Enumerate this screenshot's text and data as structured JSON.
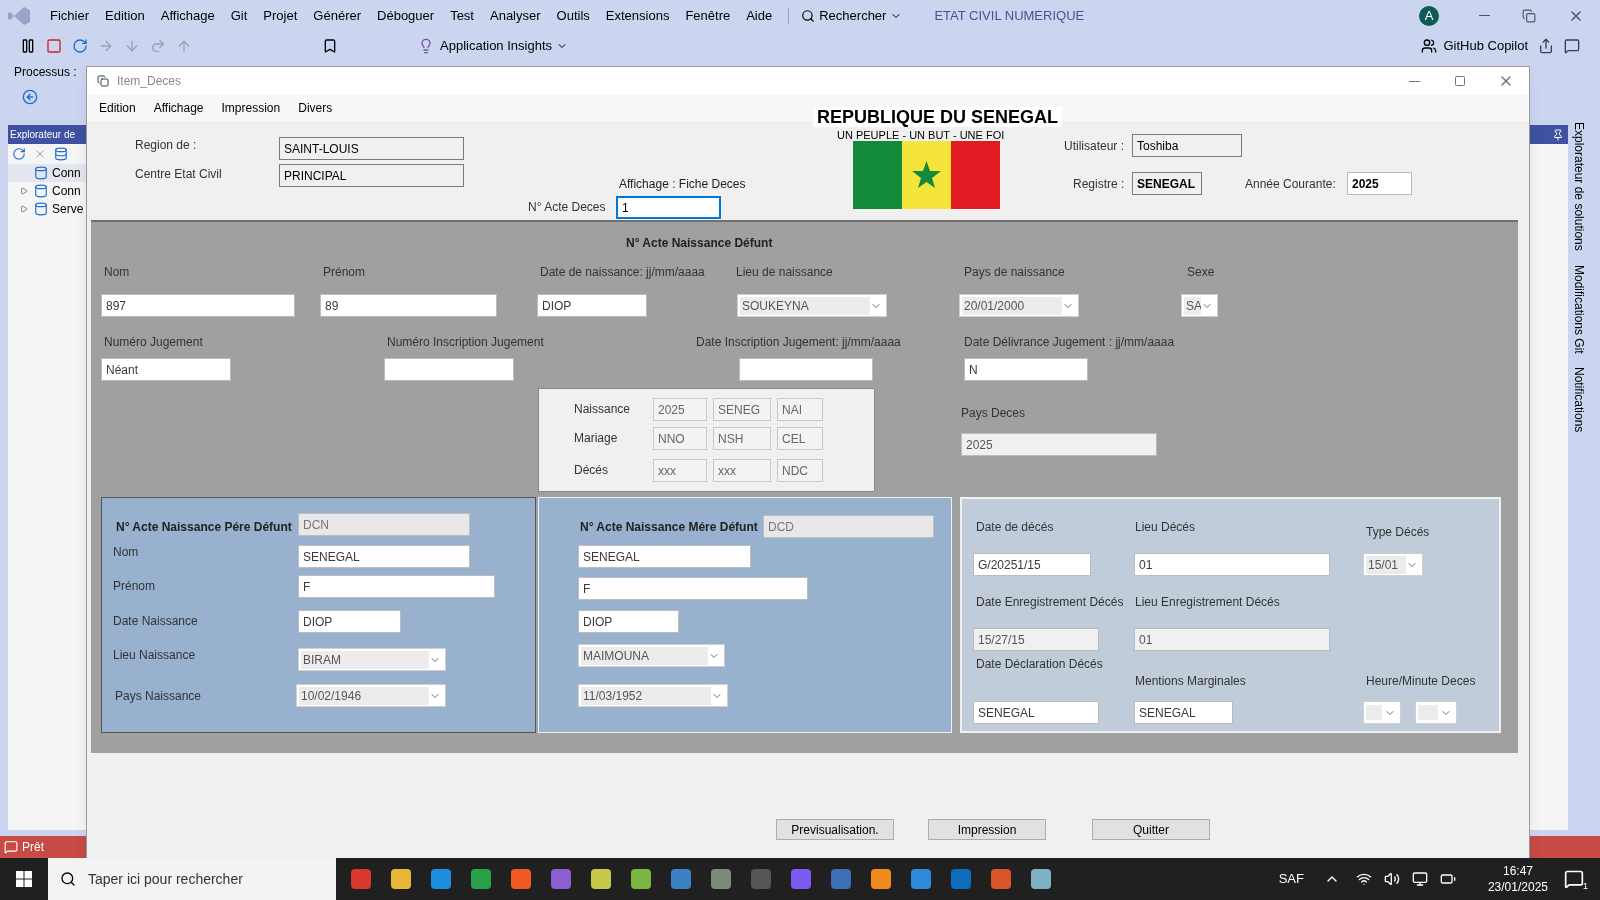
{
  "ide": {
    "menu": [
      "Fichier",
      "Edition",
      "Affichage",
      "Git",
      "Projet",
      "Générer",
      "Déboguer",
      "Test",
      "Analyser",
      "Outils",
      "Extensions",
      "Fenêtre",
      "Aide"
    ],
    "search": "Rechercher",
    "solution": "ETAT CIVIL NUMERIQUE",
    "avatar": "A",
    "insights": "Application Insights",
    "copilot": "GitHub Copilot",
    "process_label": "Processus :",
    "explorer": {
      "title": "Explorateur de",
      "items": [
        {
          "label": "Conn",
          "expandable": false
        },
        {
          "label": "Conn",
          "expandable": true
        },
        {
          "label": "Serve",
          "expandable": true
        }
      ]
    },
    "side_tabs": [
      "Explorateur de solutions",
      "Modifications Git",
      "Notifications"
    ],
    "status": "Prêt"
  },
  "form": {
    "title": "Item_Deces",
    "menu": [
      "Edition",
      "Affichage",
      "Impression",
      "Divers"
    ],
    "header": {
      "country": "REPUBLIQUE DU SENEGAL",
      "motto": "UN PEUPLE - UN BUT - UNE FOI"
    },
    "top_fields": [
      {
        "label": "Region de :",
        "value": "SAINT-LOUIS",
        "readonly": true,
        "bold": false
      },
      {
        "label": "Centre Etat Civil",
        "value": "PRINCIPAL",
        "readonly": true,
        "bold": false
      },
      {
        "label": "Utilisateur :",
        "value": "Toshiba",
        "readonly": true,
        "bold": false
      },
      {
        "label": "Registre :",
        "value": "SENEGAL",
        "readonly": true,
        "bold": true
      },
      {
        "label": "Année  Courante:",
        "value": "2025",
        "readonly": false,
        "bold": true
      }
    ],
    "display_mode": "Affichage : Fiche Deces",
    "acte": {
      "label": "N° Acte Deces",
      "value": "1",
      "focused": true
    },
    "defunt": {
      "title": "N° Acte Naissance Défunt",
      "fields": [
        {
          "label": "Nom",
          "value": "897",
          "kind": "text",
          "disabled": false
        },
        {
          "label": "Prénom",
          "value": "89",
          "kind": "text",
          "disabled": false
        },
        {
          "label": "Date de naissance: jj/mm/aaaa",
          "value": "DIOP",
          "kind": "text",
          "disabled": false
        },
        {
          "label": "Lieu de naissance",
          "value": "SOUKEYNA",
          "kind": "combo",
          "disabled": false
        },
        {
          "label": "Pays de naissance",
          "value": "20/01/2000",
          "kind": "combo",
          "disabled": false
        },
        {
          "label": "Sexe",
          "value": "SA",
          "kind": "combo",
          "disabled": false
        },
        {
          "label": "Numéro Jugement",
          "value": "Néant",
          "kind": "text",
          "disabled": false
        },
        {
          "label": "Numéro  Inscription Jugement",
          "kind": "text",
          "disabled": false
        },
        {
          "label": "Date Inscription Jugement: jj/mm/aaaa",
          "kind": "text",
          "disabled": false
        },
        {
          "label": "Date Délivrance Jugement : jj/mm/aaaa",
          "value": "N",
          "kind": "text",
          "disabled": false
        }
      ]
    },
    "codes": [
      {
        "label": "Naissance",
        "cells": [
          "2025",
          "SENEG",
          "NAI"
        ]
      },
      {
        "label": "Mariage",
        "cells": [
          "NNO",
          "NSH",
          "CEL"
        ]
      },
      {
        "label": "Décés",
        "cells": [
          "xxx",
          "xxx",
          "NDC"
        ]
      }
    ],
    "pays_deces": {
      "label": "Pays Deces",
      "value": "2025",
      "disabled": true
    },
    "pere": {
      "title": "N° Acte Naissance Pére Défunt",
      "code": "DCN",
      "code_disabled": true,
      "fields": [
        {
          "label": "Nom",
          "value": "SENEGAL",
          "kind": "text",
          "disabled": false
        },
        {
          "label": "Prénom",
          "value": "F",
          "kind": "text",
          "disabled": false
        },
        {
          "label": "Date Naissance",
          "value": "DIOP",
          "kind": "text",
          "disabled": false
        },
        {
          "label": "Lieu Naissance",
          "value": "BIRAM",
          "kind": "combo",
          "disabled": false
        },
        {
          "label": "Pays Naissance",
          "value": "10/02/1946",
          "kind": "combo",
          "disabled": false
        }
      ]
    },
    "mere": {
      "title": "N° Acte Naissance Mére Défunt",
      "code": "DCD",
      "code_disabled": true,
      "fields": [
        {
          "value": "SENEGAL",
          "kind": "text",
          "disabled": false
        },
        {
          "value": "F",
          "kind": "text",
          "disabled": false
        },
        {
          "value": "DIOP",
          "kind": "text",
          "disabled": false
        },
        {
          "value": "MAIMOUNA",
          "kind": "combo",
          "disabled": false
        },
        {
          "value": "11/03/1952",
          "kind": "combo",
          "disabled": false
        }
      ]
    },
    "deces": {
      "fields": [
        {
          "label": "Date de décés",
          "value": "G/20251/15",
          "kind": "text",
          "disabled": false
        },
        {
          "label": "Lieu Décés",
          "value": "01",
          "kind": "text",
          "disabled": false
        },
        {
          "label": "Type Décés",
          "value": "15/01",
          "kind": "combo",
          "disabled": false
        },
        {
          "label": "Date Enregistrement Décés",
          "value": "15/27/15",
          "kind": "text",
          "disabled": true
        },
        {
          "label": "Lieu Enregistrement Décés",
          "value": "01",
          "kind": "text",
          "disabled": true
        },
        {
          "label": "Date Déclaration Décés",
          "value": "SENEGAL",
          "kind": "text",
          "disabled": false
        },
        {
          "label": "Mentions Marginales",
          "value": "SENEGAL",
          "kind": "text",
          "disabled": false
        },
        {
          "label": "Heure/Minute Deces",
          "kind": "combo_pair",
          "disabled": false
        }
      ]
    },
    "buttons": [
      "Previsualisation.",
      "Impression",
      "Quitter"
    ]
  },
  "taskbar": {
    "search_placeholder": "Taper ici pour rechercher",
    "tray_label": "SAF",
    "time": "16:47",
    "date": "23/01/2025",
    "notifications": "1"
  }
}
